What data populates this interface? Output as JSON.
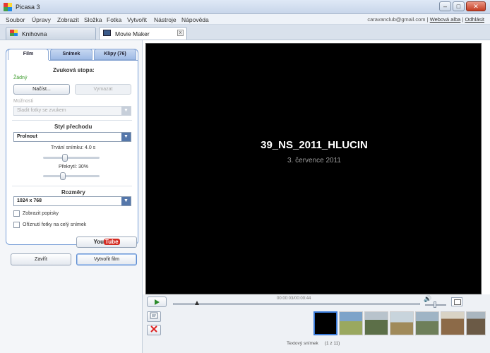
{
  "window": {
    "title": "Picasa 3",
    "controls": [
      "–",
      "□",
      "✕"
    ]
  },
  "menu": {
    "items": [
      "Soubor",
      "Úpravy",
      "Zobrazit",
      "Složka",
      "Fotka",
      "Vytvořit",
      "Nástroje",
      "Nápověda"
    ],
    "account": "caravanclub@gmail.com",
    "web_albums": "Webová alba",
    "logout": "Odhlásit",
    "separator": "|"
  },
  "tabs": {
    "library": "Knihovna",
    "movie_maker": "Movie Maker",
    "close_glyph": "x"
  },
  "left_panel": {
    "tabs": [
      "Film",
      "Snímek",
      "Klipy (76)"
    ],
    "audio_title": "Zvuková stopa:",
    "audio_status": "Žádný",
    "load_button": "Načíst...",
    "remove_button": "Vymazat",
    "options_label": "Možnosti",
    "options_value": "Sladit fotky se zvukem",
    "transition_title": "Styl přechodu",
    "transition_value": "Prolnout",
    "slide_duration": "Trvání snímku: 4.0 s",
    "overlap": "Překrytí: 30%",
    "dimensions_title": "Rozměry",
    "dimensions_value": "1024 x 768",
    "show_captions": "Zobrazit popisky",
    "crop_fill": "Oříznutí fotky na celý snímek",
    "slide_duration_fraction": 0.4,
    "overlap_fraction": 0.3
  },
  "buttons": {
    "youtube_you": "You",
    "youtube_tube": "Tube",
    "close": "Zavřít",
    "create_movie": "Vytvořit film"
  },
  "preview": {
    "title": "39_NS_2011_HLUCIN",
    "date": "3. července 2011"
  },
  "player": {
    "time": "00:00:03/00:00:44",
    "volume_glyph": "🔊",
    "playback_fraction": 0.07
  },
  "filmstrip": {
    "status": "Textový snímek",
    "position": "(1 z 11)"
  },
  "colors": {
    "accent": "#5577aa",
    "panel_border": "#7aa0d8",
    "status_green": "#3a9a2a"
  }
}
